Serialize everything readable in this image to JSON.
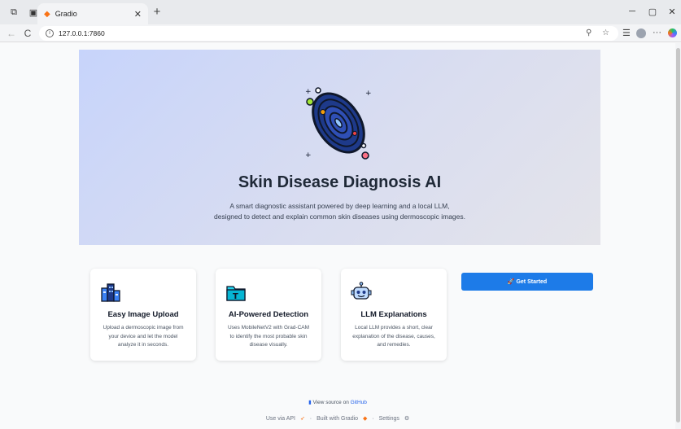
{
  "browser": {
    "tab_title": "Gradio",
    "tab_close": "✕",
    "new_tab": "+",
    "url": "127.0.0.1:7860",
    "minimize": "─",
    "restore": "▢",
    "close": "✕",
    "back": "←",
    "reload": "C",
    "more": "···"
  },
  "hero": {
    "title": "Skin Disease Diagnosis AI",
    "subtitle_line1": "A smart diagnostic assistant powered by deep learning and a local LLM,",
    "subtitle_line2": "designed to detect and explain common skin diseases using dermoscopic images."
  },
  "cards": [
    {
      "title": "Easy Image Upload",
      "desc1": "Upload a dermoscopic image from",
      "desc2": "your device and let the model",
      "desc3": "analyze it in seconds.",
      "icon": "buildings-icon"
    },
    {
      "title": "AI-Powered Detection",
      "desc1": "Uses MobileNetV2 with Grad-CAM",
      "desc2": "to identify the most probable skin",
      "desc3": "disease visually.",
      "icon": "folder-text-icon"
    },
    {
      "title": "LLM Explanations",
      "desc1": "Local LLM provides a short, clear",
      "desc2": "explanation of the disease, causes,",
      "desc3": "and remedies.",
      "icon": "robot-icon"
    }
  ],
  "get_started": "🚀 Get Started",
  "footer": {
    "view_source_prefix": "View source on",
    "github": "GitHub",
    "use_via_api": "Use via API",
    "built_with": "Built with Gradio",
    "settings": "Settings",
    "sep": "·"
  },
  "colors": {
    "accent": "#1d7be8",
    "hero_start": "#c7d4fb",
    "hero_end": "#e4e4ea"
  }
}
